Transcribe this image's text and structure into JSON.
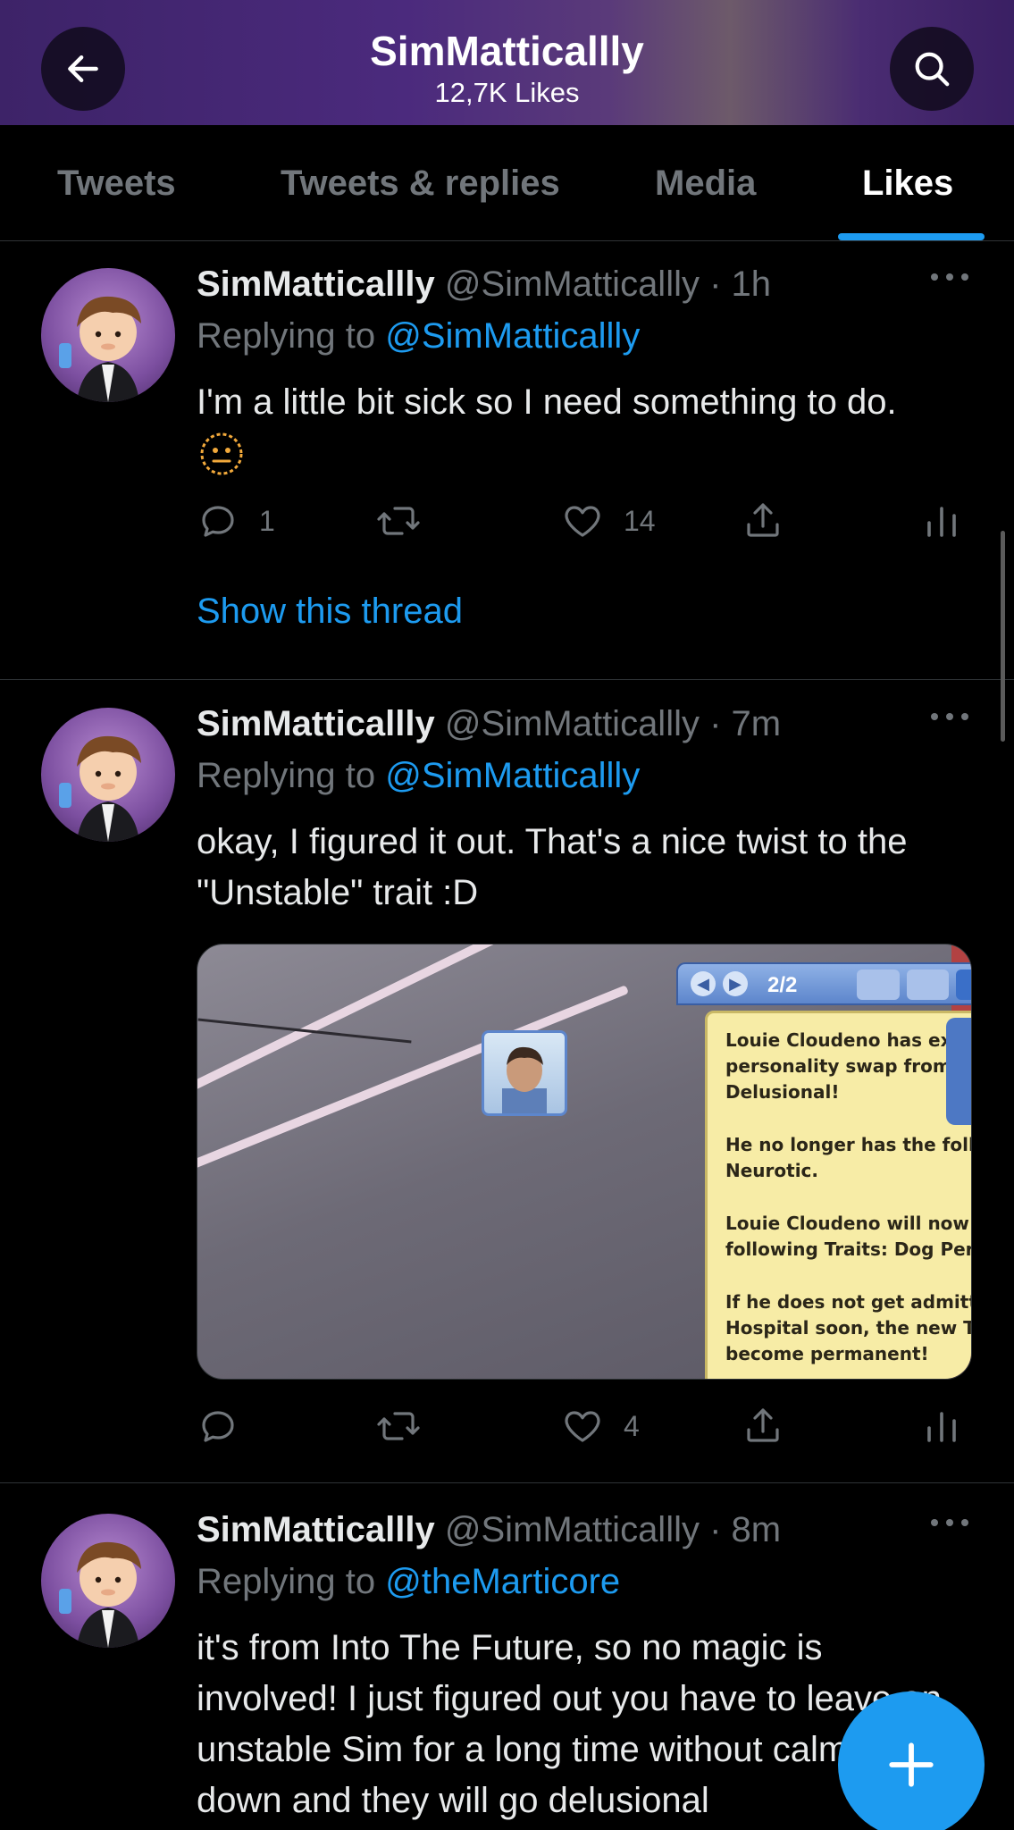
{
  "header": {
    "title": "SimMatticallly",
    "likes": "12,7K Likes"
  },
  "tabs": [
    {
      "label": "Tweets"
    },
    {
      "label": "Tweets & replies"
    },
    {
      "label": "Media"
    },
    {
      "label": "Likes"
    }
  ],
  "active_tab": "Likes",
  "tweets": [
    {
      "name": "SimMatticallly",
      "handle": "@SimMatticallly",
      "time": "· 1h",
      "replying_prefix": "Replying to ",
      "replying_to": "@SimMatticallly",
      "text": "I'm a little bit sick so I need something to do.",
      "emoji": "neutral-face-outline",
      "replies": "1",
      "retweets": "",
      "likes": "14",
      "show_thread": "Show this thread"
    },
    {
      "name": "SimMatticallly",
      "handle": "@SimMatticallly",
      "time": "· 7m",
      "replying_prefix": "Replying to ",
      "replying_to": "@SimMatticallly",
      "text": "okay, I figured it out. That's a nice twist to the \"Unstable\" trait :D",
      "replies": "",
      "retweets": "",
      "likes": "4",
      "media": {
        "page": "2/2",
        "close": "×",
        "paragraphs": [
          "Louie Cloudeno has experienced a personality swap from being Delusional!",
          "He no longer has the following Traits: Neurotic.",
          "Louie Cloudeno will now have the following Traits: Dog Person.",
          "If he does not get admitted to the Hospital soon, the new Traits will become permanent!"
        ]
      }
    },
    {
      "name": "SimMatticallly",
      "handle": "@SimMatticallly",
      "time": "· 8m",
      "replying_prefix": "Replying to ",
      "replying_to": "@theMarticore",
      "text": "it's from Into The Future, so no magic is involved! I just figured out you have to leave an unstable Sim for a long time without calming down and they will go delusional"
    }
  ],
  "colors": {
    "accent": "#1d9bf0",
    "muted": "#71767b",
    "background": "#000000",
    "header_purple": "#4b2a7d"
  }
}
